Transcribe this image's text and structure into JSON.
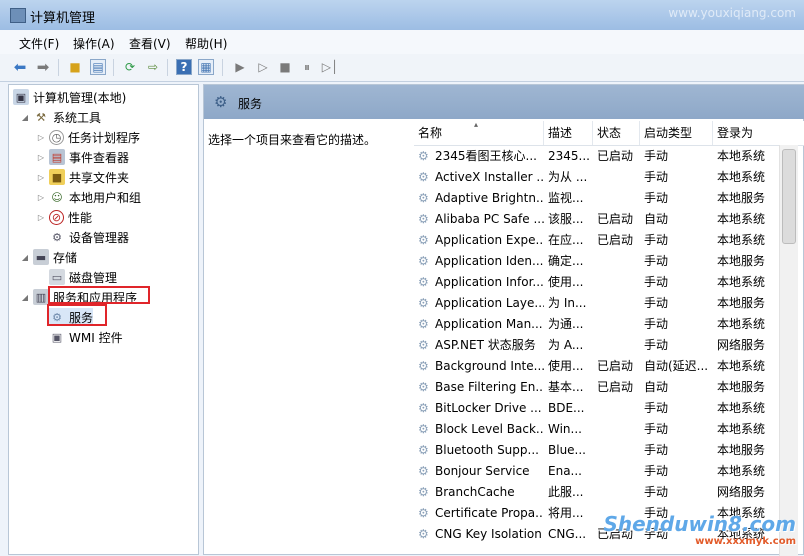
{
  "window": {
    "title": "计算机管理",
    "corner_watermark": "www.youxiqiang.com"
  },
  "menu": [
    "文件(F)",
    "操作(A)",
    "查看(V)",
    "帮助(H)"
  ],
  "toolbar_icons": [
    "back-arrow",
    "forward-arrow",
    "up-folder",
    "show-hide-tree",
    "refresh",
    "export-list",
    "help",
    "properties",
    "play",
    "play-alt",
    "stop",
    "pause",
    "restart"
  ],
  "tree": {
    "root": "计算机管理(本地)",
    "system_tools": "系统工具",
    "task_scheduler": "任务计划程序",
    "event_viewer": "事件查看器",
    "shared_folders": "共享文件夹",
    "local_users": "本地用户和组",
    "performance": "性能",
    "device_manager": "设备管理器",
    "storage": "存储",
    "disk_mgmt": "磁盘管理",
    "services_apps": "服务和应用程序",
    "services": "服务",
    "wmi": "WMI 控件"
  },
  "panel": {
    "title": "服务",
    "description_prompt": "选择一个项目来查看它的描述。"
  },
  "columns": [
    "名称",
    "描述",
    "状态",
    "启动类型",
    "登录为"
  ],
  "rows": [
    [
      "2345看图王核心...",
      "2345...",
      "已启动",
      "手动",
      "本地系统"
    ],
    [
      "ActiveX Installer ...",
      "为从 ...",
      "",
      "手动",
      "本地系统"
    ],
    [
      "Adaptive Brightn...",
      "监视...",
      "",
      "手动",
      "本地服务"
    ],
    [
      "Alibaba PC Safe ...",
      "该服...",
      "已启动",
      "自动",
      "本地系统"
    ],
    [
      "Application Expe...",
      "在应...",
      "已启动",
      "手动",
      "本地系统"
    ],
    [
      "Application Iden...",
      "确定...",
      "",
      "手动",
      "本地服务"
    ],
    [
      "Application Infor...",
      "使用...",
      "",
      "手动",
      "本地系统"
    ],
    [
      "Application Laye...",
      "为 In...",
      "",
      "手动",
      "本地服务"
    ],
    [
      "Application Man...",
      "为通...",
      "",
      "手动",
      "本地系统"
    ],
    [
      "ASP.NET 状态服务",
      "为 A...",
      "",
      "手动",
      "网络服务"
    ],
    [
      "Background Inte...",
      "使用...",
      "已启动",
      "自动(延迟...",
      "本地系统"
    ],
    [
      "Base Filtering En...",
      "基本...",
      "已启动",
      "自动",
      "本地服务"
    ],
    [
      "BitLocker Drive ...",
      "BDE...",
      "",
      "手动",
      "本地系统"
    ],
    [
      "Block Level Back...",
      "Win...",
      "",
      "手动",
      "本地系统"
    ],
    [
      "Bluetooth Supp...",
      "Blue...",
      "",
      "手动",
      "本地服务"
    ],
    [
      "Bonjour Service",
      "Ena...",
      "",
      "手动",
      "本地系统"
    ],
    [
      "BranchCache",
      "此服...",
      "",
      "手动",
      "网络服务"
    ],
    [
      "Certificate Propa...",
      "将用...",
      "",
      "手动",
      "本地系统"
    ],
    [
      "CNG Key Isolation",
      "CNG...",
      "已启动",
      "手动",
      "本地系统"
    ]
  ],
  "watermark": {
    "main": "Shenduwin8.com",
    "sub": "www.xxxmyk.com"
  }
}
